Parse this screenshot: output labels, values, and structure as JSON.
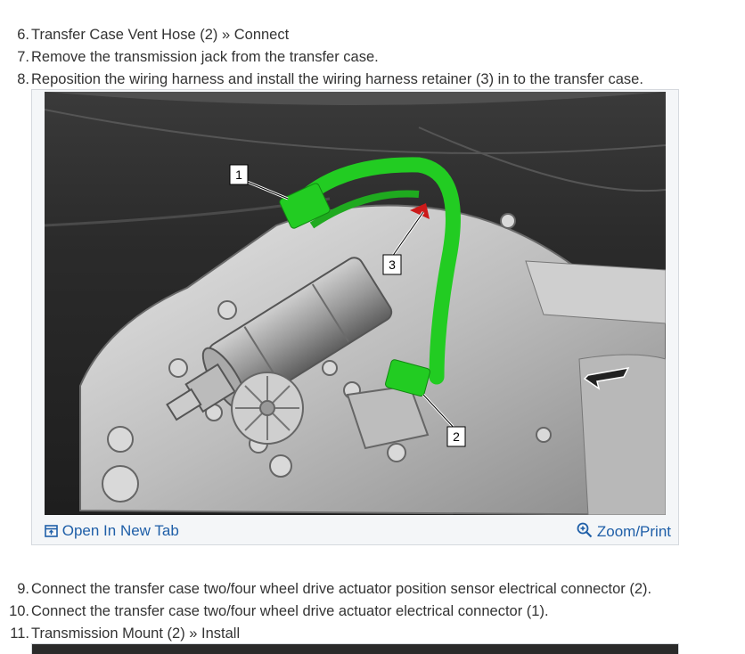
{
  "steps_top": [
    {
      "num": "6.",
      "text": "Transfer Case Vent Hose (2) » Connect"
    },
    {
      "num": "7.",
      "text": "Remove the transmission jack from the transfer case."
    },
    {
      "num": "8.",
      "text": "Reposition the wiring harness and install the wiring harness retainer (3) in to the transfer case."
    }
  ],
  "figure": {
    "callouts": [
      "1",
      "2",
      "3"
    ],
    "open_tab_label": "Open In New Tab",
    "zoom_label": "Zoom/Print",
    "open_tab_icon": "open-new-tab-icon",
    "zoom_icon": "zoom-in-icon"
  },
  "steps_bottom": [
    {
      "num": "9.",
      "text": "Connect the transfer case two/four wheel drive actuator position sensor electrical connector (2)."
    },
    {
      "num": "10.",
      "text": "Connect the transfer case two/four wheel drive actuator electrical connector (1)."
    },
    {
      "num": "11.",
      "text": "Transmission Mount (2) » Install"
    }
  ],
  "colors": {
    "link": "#1f5fa8",
    "highlight": "#22cc22"
  }
}
